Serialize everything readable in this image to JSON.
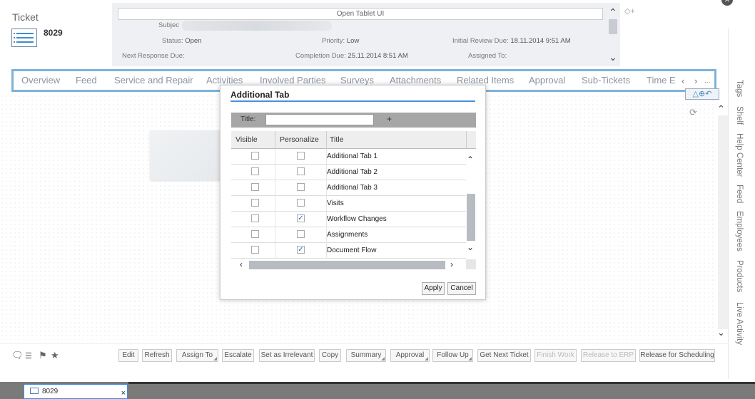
{
  "header": {
    "title": "Ticket",
    "ticket_number": "8029",
    "open_ui_label": "Open Tablet UI",
    "fields": {
      "subject_label": "Subjec",
      "status_label": "Status:",
      "status_value": "Open",
      "priority_label": "Priority:",
      "priority_value": "Low",
      "initial_review_label": "Initial Review Due:",
      "initial_review_value": "18.11.2014 9:51 AM",
      "next_response_label": "Next Response Due:",
      "completion_label": "Completion Due:",
      "completion_value": "25.11.2014 8:51 AM",
      "assigned_to_label": "Assigned To:"
    }
  },
  "tabs": [
    "Overview",
    "Feed",
    "Service and Repair",
    "Activities",
    "Involved Parties",
    "Surveys",
    "Attachments",
    "Related Items",
    "Approval",
    "Sub-Tickets",
    "Time E"
  ],
  "tab_nav": {
    "prev": "‹",
    "next": "›",
    "more": "..."
  },
  "right_rail": [
    "Tags",
    "Shelf",
    "Help Center",
    "Feed",
    "Employees",
    "Products",
    "Live Activity"
  ],
  "dialog": {
    "title": "Additional Tab",
    "title_field_label": "Title:",
    "title_field_value": "",
    "add_label": "+",
    "columns": [
      "Visible",
      "Personalize",
      "Title"
    ],
    "rows": [
      {
        "title": "Additional Tab 1",
        "visible": false,
        "personalize": false
      },
      {
        "title": "Additional Tab 2",
        "visible": false,
        "personalize": false
      },
      {
        "title": "Additional Tab 3",
        "visible": false,
        "personalize": false
      },
      {
        "title": "Visits",
        "visible": false,
        "personalize": false
      },
      {
        "title": "Workflow Changes",
        "visible": false,
        "personalize": true
      },
      {
        "title": "Assignments",
        "visible": false,
        "personalize": false
      },
      {
        "title": "Document Flow",
        "visible": false,
        "personalize": true
      }
    ],
    "apply_label": "Apply",
    "cancel_label": "Cancel"
  },
  "bottom_buttons": [
    {
      "label": "Edit",
      "disabled": false,
      "dropdown": false
    },
    {
      "label": "Refresh",
      "disabled": false,
      "dropdown": false
    },
    {
      "label": "Assign To",
      "disabled": false,
      "dropdown": true
    },
    {
      "label": "Escalate",
      "disabled": false,
      "dropdown": false
    },
    {
      "label": "Set as Irrelevant",
      "disabled": false,
      "dropdown": false
    },
    {
      "label": "Copy",
      "disabled": false,
      "dropdown": false
    },
    {
      "label": "Summary",
      "disabled": false,
      "dropdown": true
    },
    {
      "label": "Approval",
      "disabled": false,
      "dropdown": true
    },
    {
      "label": "Follow Up",
      "disabled": false,
      "dropdown": true
    },
    {
      "label": "Get Next Ticket",
      "disabled": false,
      "dropdown": false
    },
    {
      "label": "Finish Work",
      "disabled": true,
      "dropdown": false
    },
    {
      "label": "Release to ERP",
      "disabled": true,
      "dropdown": false
    },
    {
      "label": "Release for Scheduling",
      "disabled": false,
      "dropdown": false
    }
  ],
  "taskbar": {
    "item_label": "8029",
    "close_label": "×"
  },
  "colors": {
    "accent": "#4a90d9",
    "tab_border": "#7db3db",
    "checkbox_check": "#2f6db3"
  }
}
